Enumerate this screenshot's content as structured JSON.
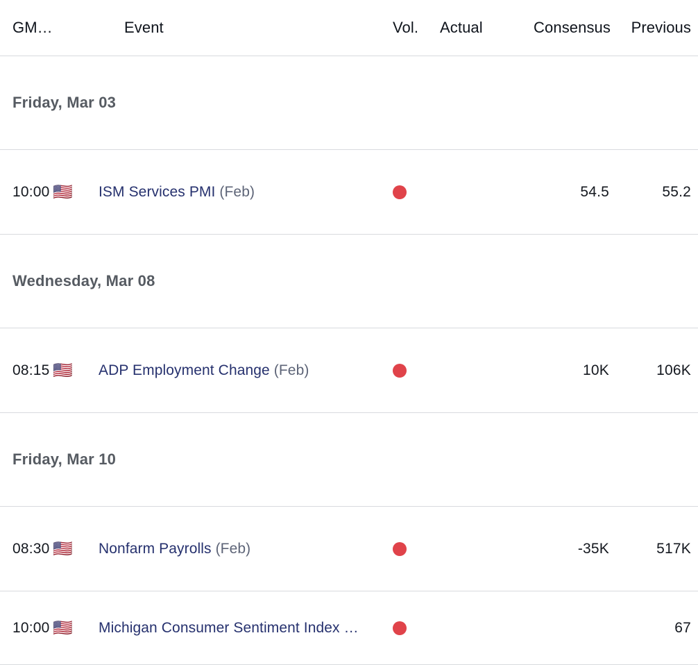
{
  "header": {
    "time_label": "GM…",
    "event_label": "Event",
    "vol_label": "Vol.",
    "actual_label": "Actual",
    "consensus_label": "Consensus",
    "previous_label": "Previous"
  },
  "colors": {
    "link": "#26316e",
    "volatility_high": "#e0434a",
    "border": "#d8dade",
    "date_text": "#565b62"
  },
  "groups": [
    {
      "date": "Friday, Mar 03",
      "events": [
        {
          "time": "10:00",
          "flag": "us-flag-icon",
          "flag_glyph": "🇺🇸",
          "name": "ISM Services PMI",
          "period": "(Feb)",
          "volatility": "high",
          "actual": "",
          "consensus": "54.5",
          "previous": "55.2"
        }
      ]
    },
    {
      "date": "Wednesday, Mar 08",
      "events": [
        {
          "time": "08:15",
          "flag": "us-flag-icon",
          "flag_glyph": "🇺🇸",
          "name": "ADP Employment Change",
          "period": "(Feb)",
          "volatility": "high",
          "actual": "",
          "consensus": "10K",
          "previous": "106K"
        }
      ]
    },
    {
      "date": "Friday, Mar 10",
      "events": [
        {
          "time": "08:30",
          "flag": "us-flag-icon",
          "flag_glyph": "🇺🇸",
          "name": "Nonfarm Payrolls",
          "period": "(Feb)",
          "volatility": "high",
          "actual": "",
          "consensus": "-35K",
          "previous": "517K"
        },
        {
          "time": "10:00",
          "flag": "us-flag-icon",
          "flag_glyph": "🇺🇸",
          "name": "Michigan Consumer Sentiment Index …",
          "period": "",
          "volatility": "high",
          "actual": "",
          "consensus": "",
          "previous": "67"
        }
      ]
    }
  ]
}
